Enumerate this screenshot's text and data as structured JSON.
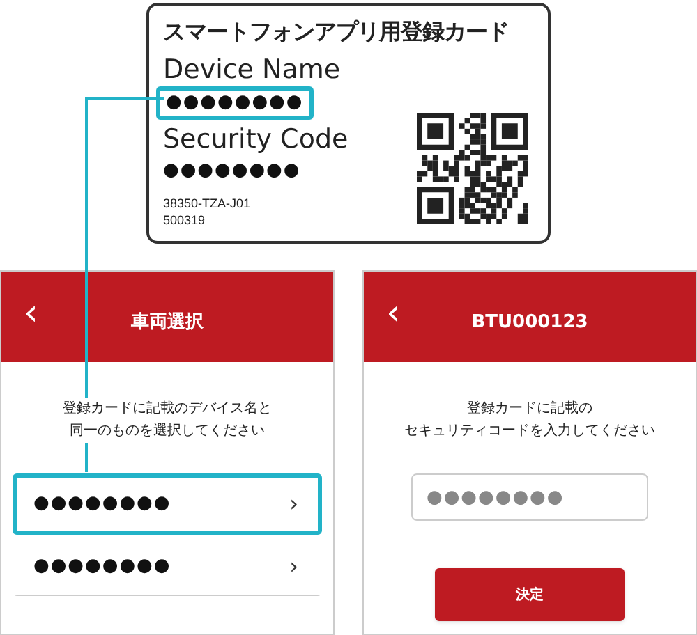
{
  "card": {
    "title": "スマートフォンアプリ用登録カード",
    "device_name_label": "Device Name",
    "device_name": "●●●●●●●●",
    "device_name_highlighted": true,
    "security_code_label": "Security Code",
    "security_code": "●●●●●●●●",
    "part_number": "38350-TZA-J01",
    "serial": "500319"
  },
  "screens": [
    {
      "kind": "list",
      "back": "‹",
      "title": "車両選択",
      "instruction": [
        "登録カードに記載のデバイス名と",
        "同一のものを選択してください"
      ],
      "items": [
        {
          "label": "●●●●●●●●",
          "chevron": "›",
          "highlighted": true
        },
        {
          "label": "●●●●●●●●",
          "chevron": "›",
          "highlighted": false
        }
      ]
    },
    {
      "kind": "form",
      "back": "‹",
      "title": "BTU000123",
      "instruction": [
        "登録カードに記載の",
        "セキュリティコードを入力してください"
      ],
      "field": {
        "placeholder": "●●●●●●●●"
      },
      "button": "決定"
    }
  ]
}
